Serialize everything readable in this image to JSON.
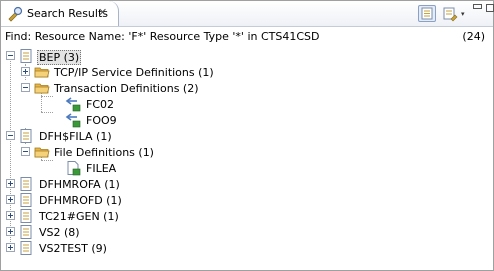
{
  "tab": {
    "title": "Search Results",
    "close_glyph": "✕"
  },
  "toolbar": {
    "dropdown_glyph": "▾"
  },
  "status": {
    "text": "Find: Resource Name: 'F*' Resource Type '*' in CTS41CSD",
    "count": "(24)"
  },
  "tree": {
    "bep": "BEP (3)",
    "tcpip": "TCP/IP Service Definitions (1)",
    "transactions": "Transaction Definitions (2)",
    "fc02": "FC02",
    "foo9": "FOO9",
    "dfhsfila": "DFH$FILA (1)",
    "files": "File Definitions (1)",
    "filea": "FILEA",
    "dfhmrofa": "DFHMROFA (1)",
    "dfhmrofd": "DFHMROFD (1)",
    "tc21": "TC21#GEN (1)",
    "vs2": "VS2 (8)",
    "vs2test": "VS2TEST (9)"
  },
  "icons": {
    "tab": "search-results-icon",
    "group": "resource-group-icon",
    "folder": "folder-icon",
    "transaction": "transaction-icon",
    "file": "file-definition-icon"
  },
  "colors": {
    "folder": "#e8b64a",
    "accent": "#4c7bc0",
    "selection": "#e4e4e4"
  }
}
